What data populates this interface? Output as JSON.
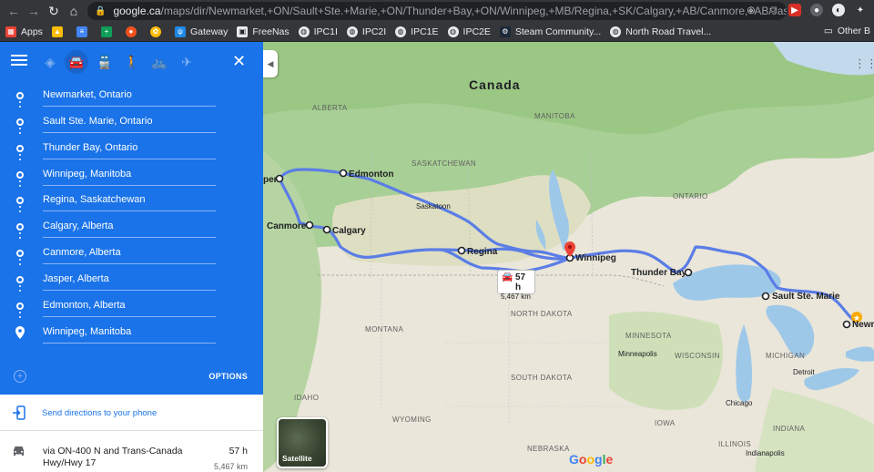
{
  "browser": {
    "url_host": "google.ca",
    "url_path": "/maps/dir/Newmarket,+ON/Sault+Ste.+Marie,+ON/Thunder+Bay,+ON/Winnipeg,+MB/Regina,+SK/Calgary,+AB/Canmore,+AB/Jasper,...",
    "bookmarks": [
      {
        "label": "Apps",
        "icon": "apps-grid-icon",
        "color": "#ea4335"
      },
      {
        "label": "",
        "icon": "drive-icon",
        "color": "#fbbc04"
      },
      {
        "label": "",
        "icon": "docs-icon",
        "color": "#4285f4"
      },
      {
        "label": "",
        "icon": "sheets-icon",
        "color": "#0f9d58"
      },
      {
        "label": "",
        "icon": "extension-orange-icon",
        "color": "#f4511e"
      },
      {
        "label": "",
        "icon": "photos-icon",
        "color": "#fbbc04"
      },
      {
        "label": "Gateway",
        "icon": "gateway-icon",
        "color": "#1e88e5"
      },
      {
        "label": "FreeNas",
        "icon": "freenas-icon",
        "color": "#424242"
      },
      {
        "label": "IPC1I",
        "icon": "globe-icon",
        "color": "#5f6368"
      },
      {
        "label": "IPC2I",
        "icon": "globe-icon",
        "color": "#5f6368"
      },
      {
        "label": "IPC1E",
        "icon": "globe-icon",
        "color": "#5f6368"
      },
      {
        "label": "IPC2E",
        "icon": "globe-icon",
        "color": "#5f6368"
      },
      {
        "label": "Steam Community...",
        "icon": "steam-icon",
        "color": "#1b2838"
      },
      {
        "label": "North Road Travel...",
        "icon": "globe-icon",
        "color": "#5f6368"
      }
    ],
    "other_bookmarks": "Other B"
  },
  "sidebar": {
    "travel_modes": [
      "best-route-icon",
      "car-icon",
      "transit-icon",
      "walk-icon",
      "bike-icon",
      "flight-icon"
    ],
    "active_mode": "car-icon",
    "stops": [
      "Newmarket, Ontario",
      "Sault Ste. Marie, Ontario",
      "Thunder Bay, Ontario",
      "Winnipeg, Manitoba",
      "Regina, Saskatchewan",
      "Calgary, Alberta",
      "Canmore, Alberta",
      "Jasper, Alberta",
      "Edmonton, Alberta",
      "Winnipeg, Manitoba"
    ],
    "options_label": "OPTIONS",
    "send_label": "Send directions to your phone",
    "route": {
      "via": "via ON-400 N and Trans-Canada Hwy/Hwy 17",
      "time": "57 h",
      "distance": "5,467 km"
    }
  },
  "map": {
    "country": "Canada",
    "provinces": [
      "ALBERTA",
      "SASKATCHEWAN",
      "MANITOBA",
      "ONTARIO"
    ],
    "states": [
      "MONTANA",
      "NORTH DAKOTA",
      "SOUTH DAKOTA",
      "WYOMING",
      "IDAHO",
      "MINNESOTA",
      "WISCONSIN",
      "MICHIGAN",
      "IOWA",
      "NEBRASKA",
      "ILLINOIS",
      "INDIANA"
    ],
    "cities": {
      "edmonton": "Edmonton",
      "calgary": "Calgary",
      "canmore": "Canmore",
      "regina": "Regina",
      "winnipeg": "Winnipeg",
      "thunder_bay": "Thunder Bay",
      "sault": "Sault Ste. Marie",
      "newmarket": "Newm",
      "jasper": "per",
      "saskatoon": "Saskatoon",
      "minneapolis": "Minneapolis",
      "chicago": "Chicago",
      "detroit": "Detroit",
      "indianapolis": "Indianapolis"
    },
    "badge": {
      "time": "57 h",
      "distance": "5,467 km"
    },
    "satellite_label": "Satellite",
    "google_letters": [
      {
        "ch": "G",
        "color": "#4285f4"
      },
      {
        "ch": "o",
        "color": "#ea4335"
      },
      {
        "ch": "o",
        "color": "#fbbc04"
      },
      {
        "ch": "g",
        "color": "#4285f4"
      },
      {
        "ch": "l",
        "color": "#34a853"
      },
      {
        "ch": "e",
        "color": "#ea4335"
      }
    ]
  }
}
